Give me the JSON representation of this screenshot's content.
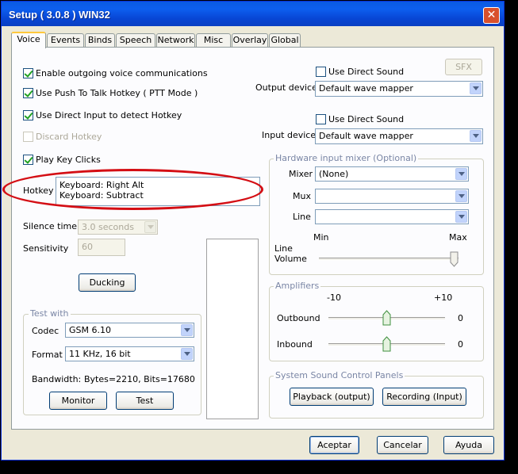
{
  "window": {
    "title": "Setup ( 3.0.8 ) WIN32",
    "close_glyph": "✕"
  },
  "tabs": [
    "Voice",
    "Events",
    "Binds",
    "Speech",
    "Network",
    "Misc",
    "Overlay",
    "Global"
  ],
  "voice": {
    "enable_outgoing": {
      "label": "Enable outgoing voice communications",
      "checked": true
    },
    "push_to_talk": {
      "label": "Use Push To Talk Hotkey ( PTT Mode )",
      "checked": true
    },
    "direct_input": {
      "label": "Use Direct Input to detect Hotkey",
      "checked": true
    },
    "discard_hotkey": {
      "label": "Discard Hotkey",
      "checked": false,
      "disabled": true
    },
    "play_key_clicks": {
      "label": "Play Key Clicks",
      "checked": true
    },
    "hotkey": {
      "label": "Hotkey",
      "lines": [
        "Keyboard: Right Alt",
        "Keyboard: Subtract"
      ]
    },
    "silence_time": {
      "label": "Silence time",
      "value": "3.0 seconds"
    },
    "sensitivity": {
      "label": "Sensitivity",
      "value": "60"
    },
    "ducking_button": "Ducking"
  },
  "output": {
    "use_direct_sound": "Use Direct Sound",
    "device_label": "Output device",
    "device_value": "Default wave mapper",
    "sfx_button": "SFX"
  },
  "input": {
    "use_direct_sound": "Use Direct Sound",
    "device_label": "Input device",
    "device_value": "Default wave mapper"
  },
  "mixer": {
    "title": "Hardware input mixer (Optional)",
    "mixer_label": "Mixer",
    "mixer_value": "(None)",
    "mux_label": "Mux",
    "mux_value": "",
    "line_label": "Line",
    "line_value": "",
    "min_label": "Min",
    "max_label": "Max",
    "line_volume_label_1": "Line",
    "line_volume_label_2": "Volume",
    "line_volume_value": 1.0
  },
  "amplifiers": {
    "title": "Amplifiers",
    "min_label": "-10",
    "max_label": "+10",
    "outbound_label": "Outbound",
    "outbound_value": "0",
    "inbound_label": "Inbound",
    "inbound_value": "0"
  },
  "test_with": {
    "title": "Test with",
    "codec_label": "Codec",
    "codec_value": "GSM 6.10",
    "format_label": "Format",
    "format_value": "11 KHz, 16 bit",
    "bandwidth_label": "Bandwidth:",
    "bandwidth_value": "Bytes=2210, Bits=17680",
    "monitor_button": "Monitor",
    "test_button": "Test"
  },
  "sound_panels": {
    "title": "System Sound Control Panels",
    "playback_button": "Playback (output)",
    "recording_button": "Recording (Input)"
  },
  "footer": {
    "ok_button": "Aceptar",
    "cancel_button": "Cancelar",
    "help_button": "Ayuda"
  },
  "colors": {
    "title_bar": "#0a5ae3",
    "tab_highlight": "#ffc83c",
    "annotation": "#d40e14",
    "check": "#21a121"
  }
}
